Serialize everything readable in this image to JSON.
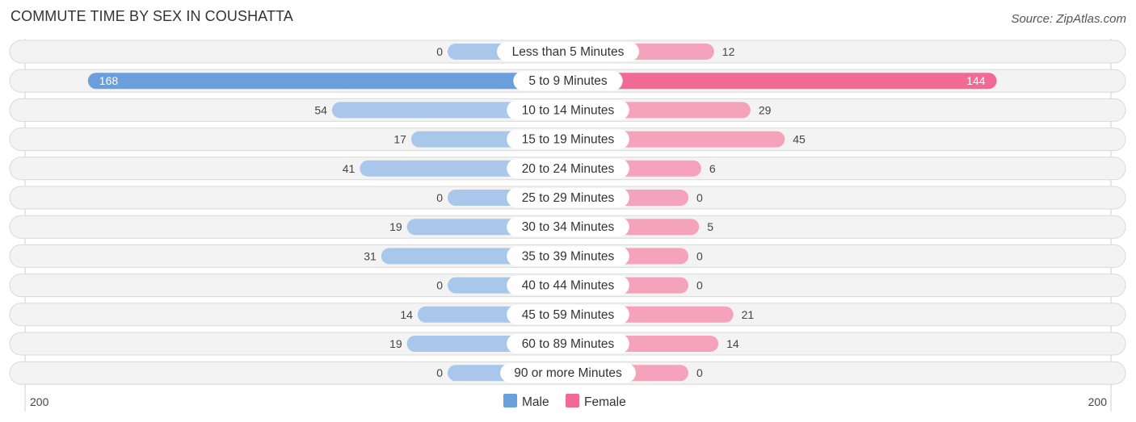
{
  "header": {
    "title": "COMMUTE TIME BY SEX IN COUSHATTA",
    "source": "Source: ZipAtlas.com"
  },
  "colors": {
    "male": "#6a9fdc",
    "male_light": "#a8c7eb",
    "female": "#f06a94",
    "female_light": "#f5a2bd"
  },
  "chart_data": {
    "type": "bar",
    "orientation": "horizontal-diverging",
    "title": "COMMUTE TIME BY SEX IN COUSHATTA",
    "categories": [
      "Less than 5 Minutes",
      "5 to 9 Minutes",
      "10 to 14 Minutes",
      "15 to 19 Minutes",
      "20 to 24 Minutes",
      "25 to 29 Minutes",
      "30 to 34 Minutes",
      "35 to 39 Minutes",
      "40 to 44 Minutes",
      "45 to 59 Minutes",
      "60 to 89 Minutes",
      "90 or more Minutes"
    ],
    "series": [
      {
        "name": "Male",
        "values": [
          0,
          168,
          54,
          17,
          41,
          0,
          19,
          31,
          0,
          14,
          19,
          0
        ]
      },
      {
        "name": "Female",
        "values": [
          12,
          144,
          29,
          45,
          6,
          0,
          5,
          0,
          0,
          21,
          14,
          0
        ]
      }
    ],
    "axis": {
      "left_label": "200",
      "right_label": "200",
      "range": [
        -200,
        200
      ]
    },
    "legend": {
      "position": "bottom-center",
      "entries": [
        "Male",
        "Female"
      ]
    },
    "grid": false
  }
}
